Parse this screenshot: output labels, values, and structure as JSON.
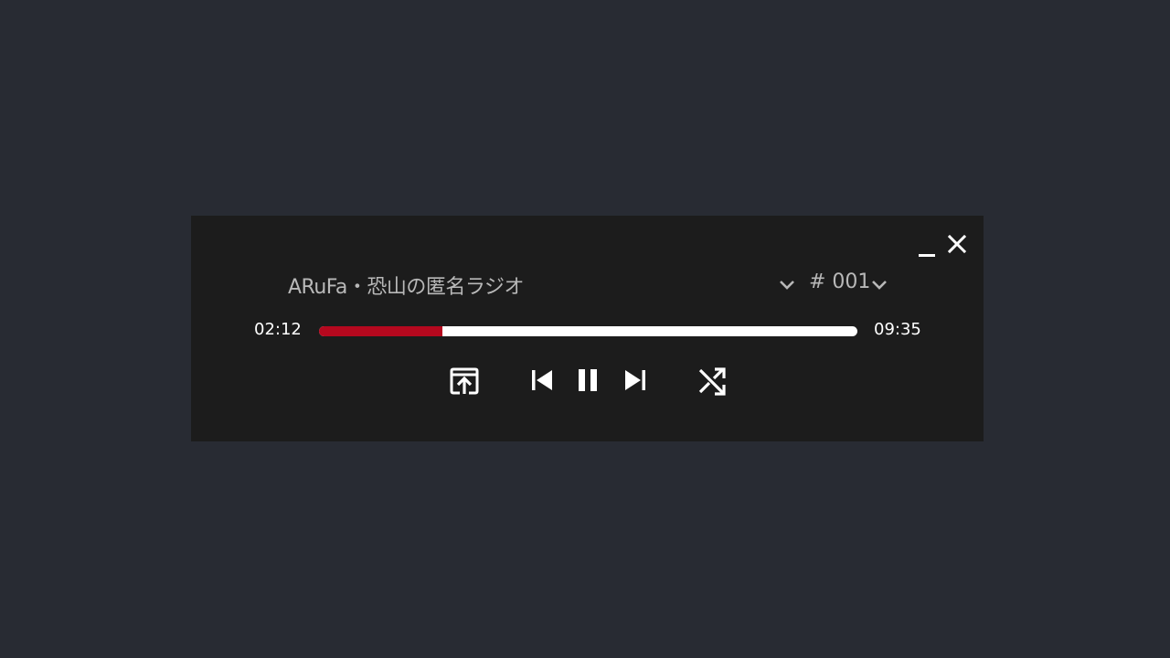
{
  "player": {
    "title": "ARuFa・恐山の匿名ラジオ",
    "episode": "# 001",
    "current_time": "02:12",
    "total_time": "09:35",
    "progress": 0.23
  },
  "icons": {
    "minimize": "minimize-icon",
    "close": "close-icon",
    "title_dropdown": "chevron-down-icon",
    "episode_dropdown": "chevron-down-icon",
    "open_external": "open-external-icon",
    "previous": "skip-previous-icon",
    "pause": "pause-icon",
    "next": "skip-next-icon",
    "shuffle": "shuffle-icon"
  },
  "colors": {
    "background": "#282b33",
    "panel": "#1c1c1c",
    "progress_played": "#b5081e",
    "progress_track": "#ffffff",
    "title_text": "#b8b8b8"
  }
}
